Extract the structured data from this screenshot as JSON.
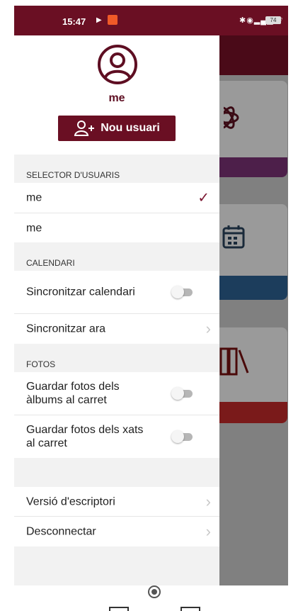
{
  "status_bar": {
    "time": "15:47",
    "battery": "74"
  },
  "drawer": {
    "username": "me",
    "new_user_button": "Nou usuari",
    "sections": {
      "users": "SELECTOR D'USUARIS",
      "calendar": "CALENDARI",
      "photos": "FOTOS"
    },
    "users": [
      {
        "name": "me",
        "selected": true
      },
      {
        "name": "me",
        "selected": false
      }
    ],
    "calendar_items": [
      {
        "label": "Sincronitzar calendari",
        "type": "toggle",
        "on": false
      },
      {
        "label": "Sincronitzar ara",
        "type": "link"
      }
    ],
    "photo_items": [
      {
        "label": "Guardar fotos dels àlbums al carret",
        "type": "toggle",
        "on": false
      },
      {
        "label": "Guardar fotos dels xats al carret",
        "type": "toggle",
        "on": false
      }
    ],
    "bottom_items": [
      {
        "label": "Versió d'escriptori",
        "type": "link"
      },
      {
        "label": "Desconnectar",
        "type": "link"
      }
    ]
  },
  "colors": {
    "brand": "#6a0f23",
    "check": "#7a1530"
  }
}
